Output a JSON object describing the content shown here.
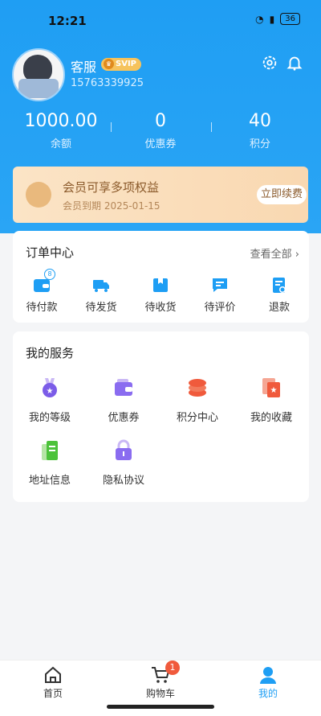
{
  "status": {
    "time": "12:21",
    "battery": "36"
  },
  "profile": {
    "name": "客服",
    "badge": "SVIP",
    "phone": "15763339925"
  },
  "stats": [
    {
      "value": "1000.00",
      "label": "余额"
    },
    {
      "value": "0",
      "label": "优惠券"
    },
    {
      "value": "40",
      "label": "积分"
    }
  ],
  "vip": {
    "title": "会员可享多项权益",
    "expire": "会员到期 2025-01-15",
    "action": "立即续费"
  },
  "orders": {
    "title": "订单中心",
    "view_all": "查看全部 ›",
    "badge": "8",
    "items": [
      {
        "label": "待付款",
        "icon": "wallet-icon"
      },
      {
        "label": "待发货",
        "icon": "truck-icon"
      },
      {
        "label": "待收货",
        "icon": "box-icon"
      },
      {
        "label": "待评价",
        "icon": "comment-icon"
      },
      {
        "label": "退款",
        "icon": "refund-icon"
      }
    ]
  },
  "services": {
    "title": "我的服务",
    "items": [
      {
        "label": "我的等级",
        "icon": "medal-icon"
      },
      {
        "label": "优惠券",
        "icon": "wallet-icon"
      },
      {
        "label": "积分中心",
        "icon": "coins-icon"
      },
      {
        "label": "我的收藏",
        "icon": "star-card-icon"
      },
      {
        "label": "地址信息",
        "icon": "address-icon"
      },
      {
        "label": "隐私协议",
        "icon": "lock-icon"
      }
    ]
  },
  "tabs": [
    {
      "label": "首页",
      "icon": "home-icon"
    },
    {
      "label": "购物车",
      "icon": "cart-icon",
      "badge": "1"
    },
    {
      "label": "我的",
      "icon": "user-icon"
    }
  ],
  "colors": {
    "brand": "#1f9ef3",
    "vip_text": "#8b5a2b",
    "badge_red": "#f05a3c"
  }
}
